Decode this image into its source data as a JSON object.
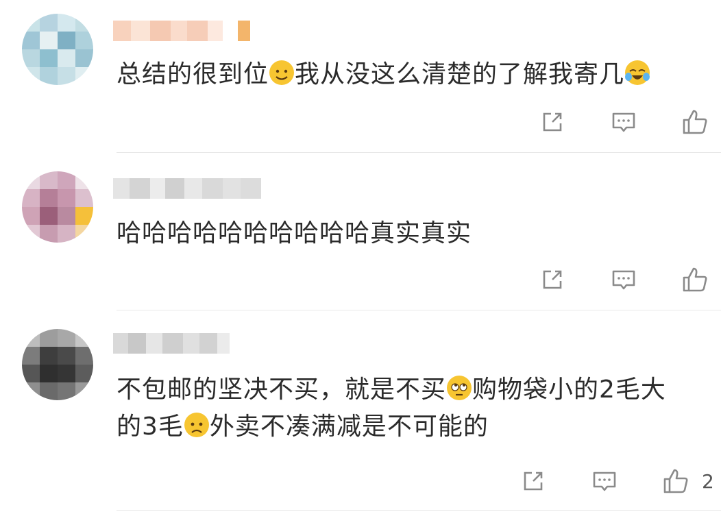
{
  "comments": [
    {
      "text_parts": [
        "总结的很到位",
        "我从没这么清楚的了解我寄几",
        ""
      ],
      "emojis": [
        "smile-emoji",
        "crying-laugh-emoji"
      ],
      "actions": {
        "share": "share-icon",
        "reply": "comment-icon",
        "like": "thumbs-up-icon"
      },
      "like_count": ""
    },
    {
      "text_parts": [
        "哈哈哈哈哈哈哈哈哈哈真实真实"
      ],
      "actions": {
        "share": "share-icon",
        "reply": "comment-icon",
        "like": "thumbs-up-icon"
      },
      "like_count": ""
    },
    {
      "text_parts": [
        "不包邮的坚决不买，就是不买",
        "购物袋小的2毛大",
        "的3毛",
        "外卖不凑满减是不可能的"
      ],
      "emojis": [
        "eye-roll-emoji",
        "frown-emoji"
      ],
      "actions": {
        "share": "share-icon",
        "reply": "comment-icon",
        "like": "thumbs-up-icon"
      },
      "like_count": "2"
    }
  ],
  "colors": {
    "text": "#2b2b2b",
    "icon": "#8a8a8a",
    "divider": "#e8e8e8",
    "emoji_yellow": "#f7c531"
  }
}
